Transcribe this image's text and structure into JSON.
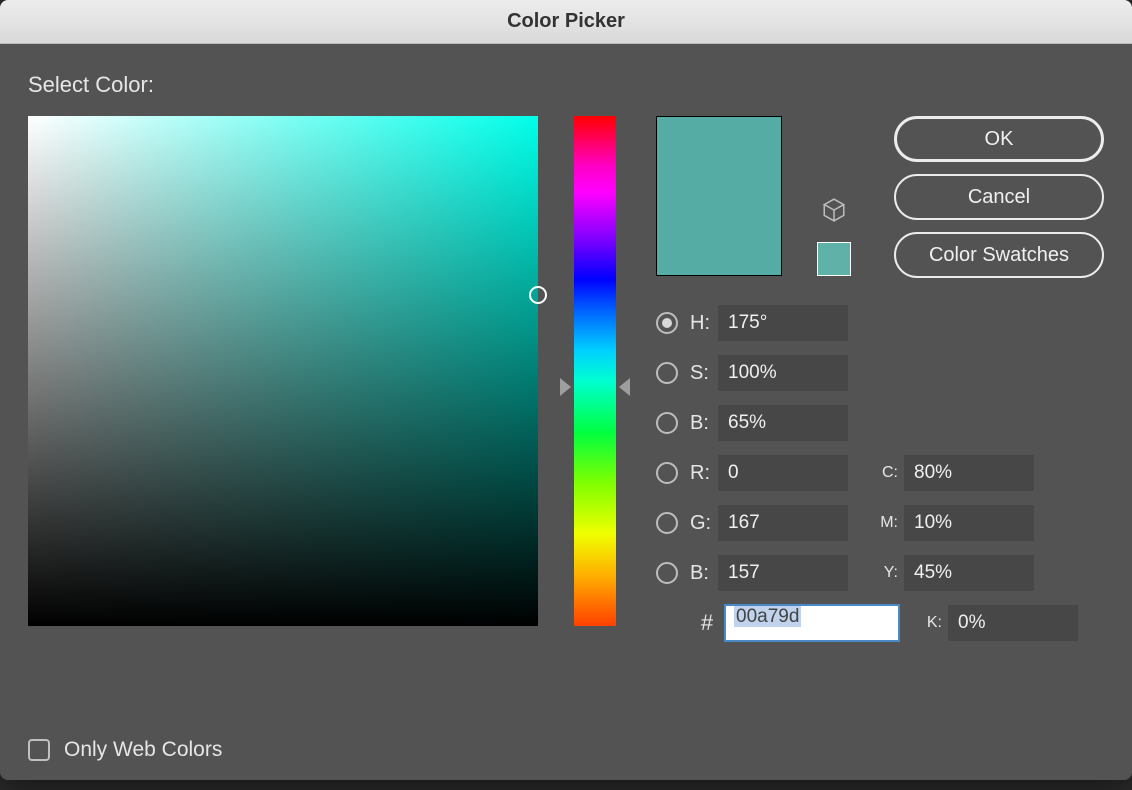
{
  "title": "Color Picker",
  "select_label": "Select Color:",
  "buttons": {
    "ok": "OK",
    "cancel": "Cancel",
    "swatches": "Color Swatches"
  },
  "current_color": "#55aca4",
  "mini_swatch_color": "#60b1a7",
  "hsb": {
    "h_label": "H:",
    "h_value": "175°",
    "s_label": "S:",
    "s_value": "100%",
    "b_label": "B:",
    "b_value": "65%"
  },
  "rgb": {
    "r_label": "R:",
    "r_value": "0",
    "g_label": "G:",
    "g_value": "167",
    "b_label": "B:",
    "b_value": "157"
  },
  "cmyk": {
    "c_label": "C:",
    "c_value": "80%",
    "m_label": "M:",
    "m_value": "10%",
    "y_label": "Y:",
    "y_value": "45%",
    "k_label": "K:",
    "k_value": "0%"
  },
  "hex": {
    "hash": "#",
    "value": "00a79d"
  },
  "web_only_label": "Only Web Colors",
  "selected_radio": "H"
}
